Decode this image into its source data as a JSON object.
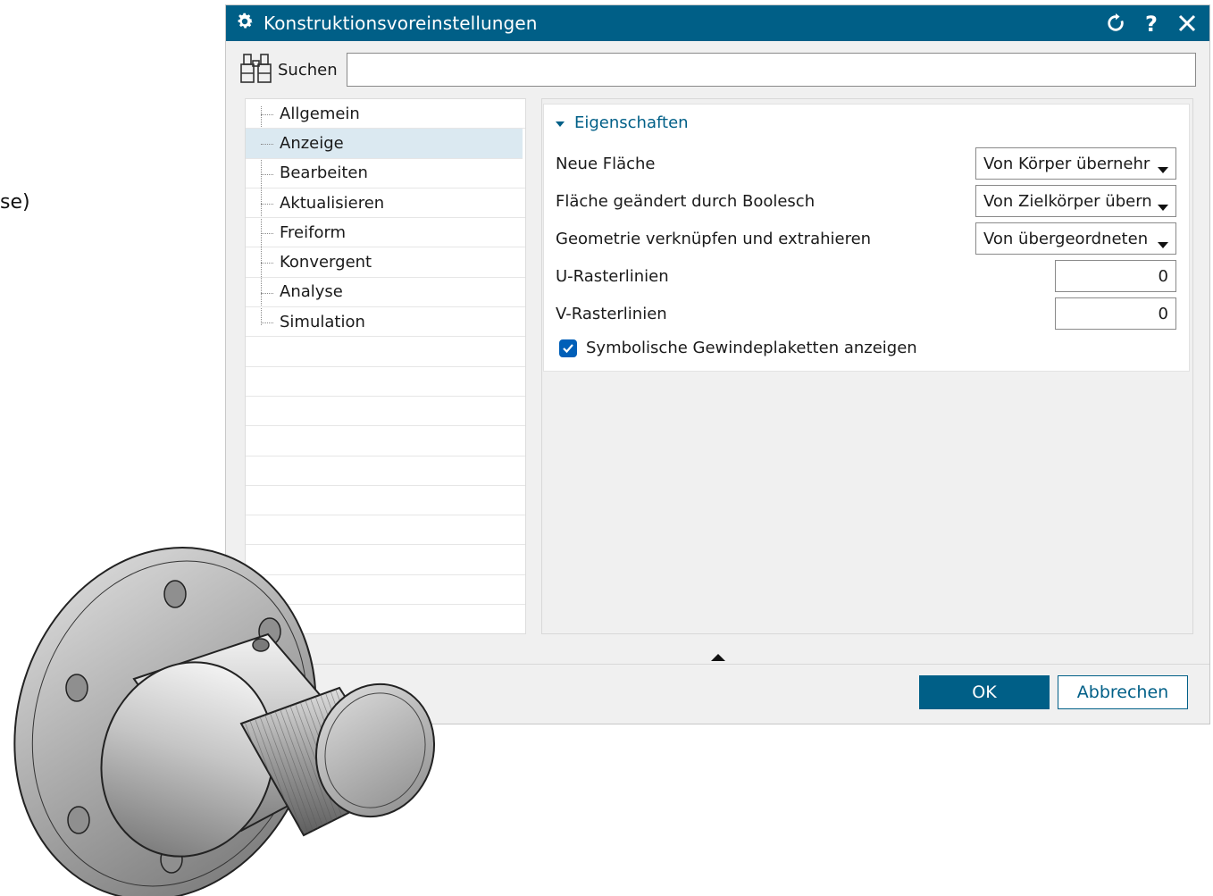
{
  "background": {
    "partial_text": "se)"
  },
  "dialog": {
    "title": "Konstruktionsvoreinstellungen",
    "title_icon": "gear-icon",
    "actions": [
      "reset-icon",
      "help-icon",
      "close-icon"
    ],
    "accent_color": "#005f87"
  },
  "search": {
    "label": "Suchen",
    "value": "",
    "icon": "binoculars-icon"
  },
  "tree": {
    "items": [
      {
        "label": "Allgemein",
        "selected": false
      },
      {
        "label": "Anzeige",
        "selected": true
      },
      {
        "label": "Bearbeiten",
        "selected": false
      },
      {
        "label": "Aktualisieren",
        "selected": false
      },
      {
        "label": "Freiform",
        "selected": false
      },
      {
        "label": "Konvergent",
        "selected": false
      },
      {
        "label": "Analyse",
        "selected": false
      },
      {
        "label": "Simulation",
        "selected": false
      }
    ]
  },
  "properties": {
    "section_title": "Eigenschaften",
    "rows": [
      {
        "label": "Neue Fläche",
        "value": "Von Körper übernehr"
      },
      {
        "label": "Fläche geändert durch Boolesch",
        "value": "Von Zielkörper übern"
      },
      {
        "label": "Geometrie verknüpfen und extrahieren",
        "value": "Von übergeordneten"
      },
      {
        "label": "U-Rasterlinien",
        "value": "0"
      },
      {
        "label": "V-Rasterlinien",
        "value": "0"
      }
    ],
    "checkbox": {
      "label": "Symbolische Gewindeplaketten anzeigen",
      "checked": true
    }
  },
  "buttons": {
    "ok": "OK",
    "cancel": "Abbrechen"
  }
}
